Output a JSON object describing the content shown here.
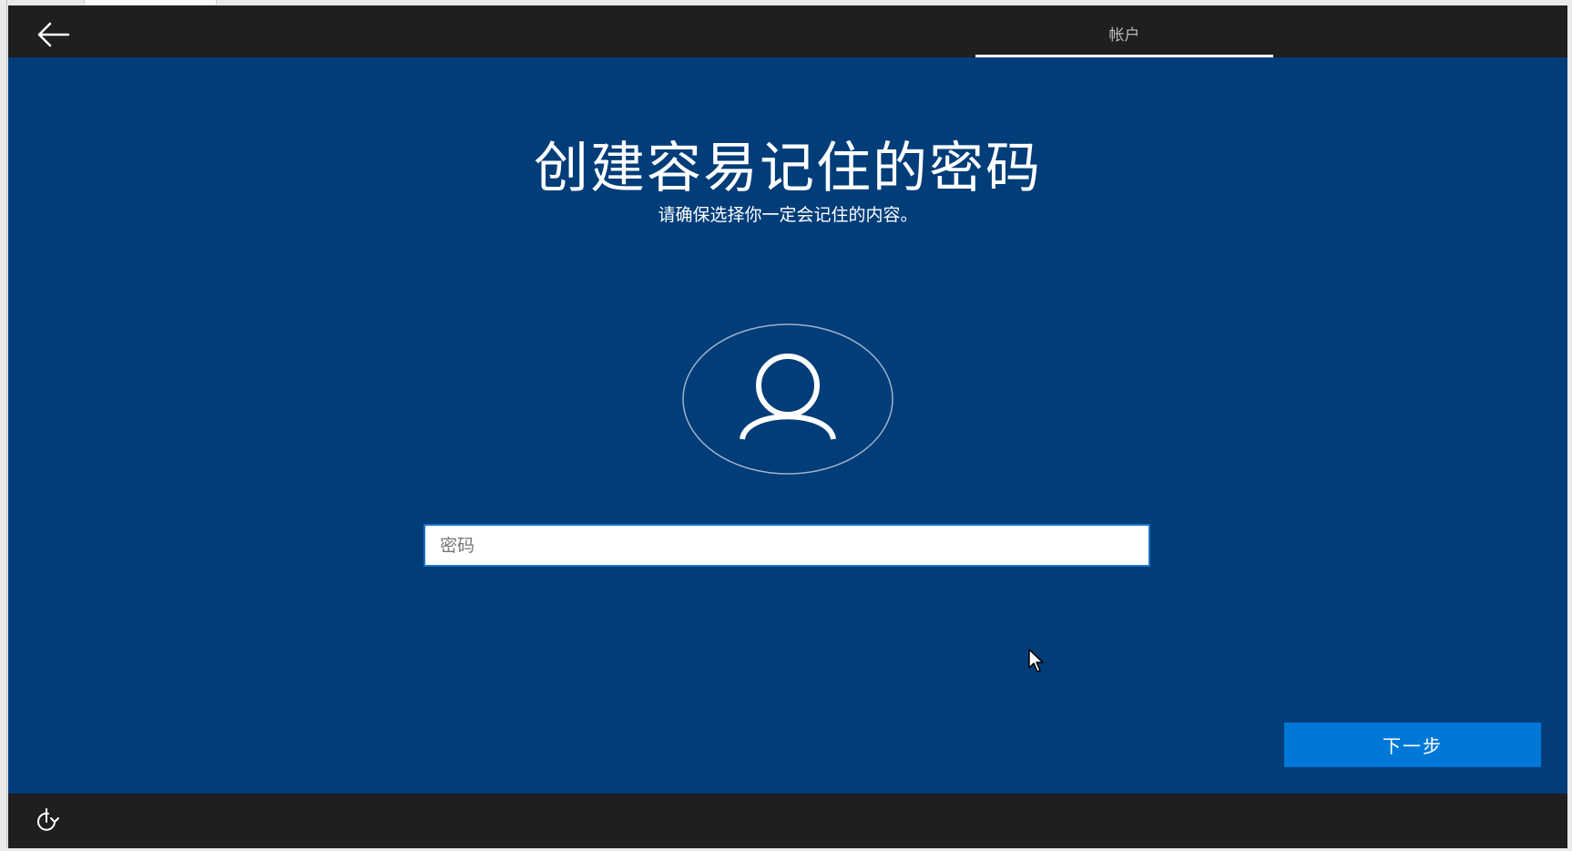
{
  "header": {
    "back_icon": "back-arrow-icon",
    "tab_label": "帐户"
  },
  "main": {
    "title": "创建容易记住的密码",
    "subtitle": "请确保选择你一定会记住的内容。",
    "avatar_icon": "user-icon",
    "password_field": {
      "placeholder": "密码",
      "value": ""
    },
    "next_button_label": "下一步"
  },
  "footer": {
    "accessibility_icon": "ease-of-access-icon"
  },
  "colors": {
    "header_bg": "#1f1f1f",
    "main_bg": "#003d79",
    "accent": "#0078d7",
    "text": "#ffffff",
    "tab_label": "#bdbdbd"
  }
}
